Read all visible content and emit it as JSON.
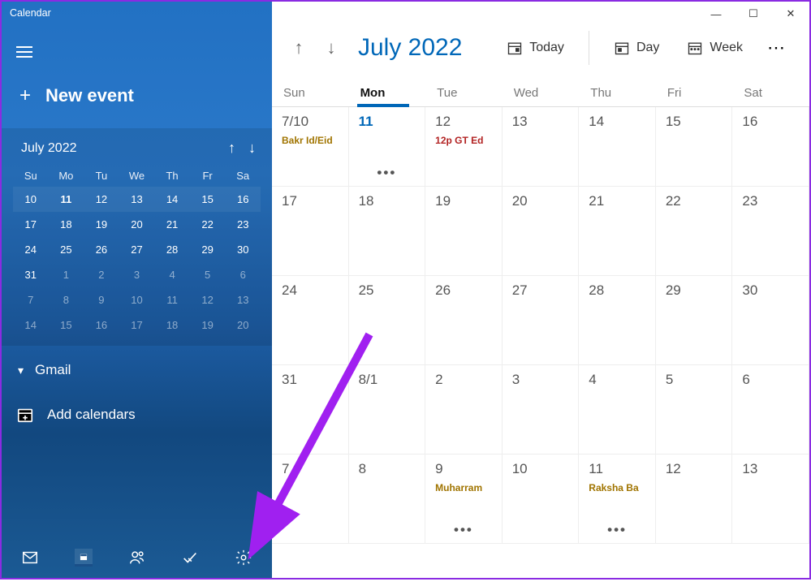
{
  "app_title": "Calendar",
  "new_event_label": "New event",
  "mini_cal": {
    "title": "July 2022",
    "dow": [
      "Su",
      "Mo",
      "Tu",
      "We",
      "Th",
      "Fr",
      "Sa"
    ],
    "weeks": [
      [
        {
          "n": "10"
        },
        {
          "n": "11",
          "today": true
        },
        {
          "n": "12"
        },
        {
          "n": "13"
        },
        {
          "n": "14"
        },
        {
          "n": "15"
        },
        {
          "n": "16"
        }
      ],
      [
        {
          "n": "17"
        },
        {
          "n": "18"
        },
        {
          "n": "19"
        },
        {
          "n": "20"
        },
        {
          "n": "21"
        },
        {
          "n": "22"
        },
        {
          "n": "23"
        }
      ],
      [
        {
          "n": "24"
        },
        {
          "n": "25"
        },
        {
          "n": "26"
        },
        {
          "n": "27"
        },
        {
          "n": "28"
        },
        {
          "n": "29"
        },
        {
          "n": "30"
        }
      ],
      [
        {
          "n": "31"
        },
        {
          "n": "1",
          "other": true
        },
        {
          "n": "2",
          "other": true
        },
        {
          "n": "3",
          "other": true
        },
        {
          "n": "4",
          "other": true
        },
        {
          "n": "5",
          "other": true
        },
        {
          "n": "6",
          "other": true
        }
      ],
      [
        {
          "n": "7",
          "other": true
        },
        {
          "n": "8",
          "other": true
        },
        {
          "n": "9",
          "other": true
        },
        {
          "n": "10",
          "other": true
        },
        {
          "n": "11",
          "other": true
        },
        {
          "n": "12",
          "other": true
        },
        {
          "n": "13",
          "other": true
        }
      ],
      [
        {
          "n": "14",
          "other": true
        },
        {
          "n": "15",
          "other": true
        },
        {
          "n": "16",
          "other": true
        },
        {
          "n": "17",
          "other": true
        },
        {
          "n": "18",
          "other": true
        },
        {
          "n": "19",
          "other": true
        },
        {
          "n": "20",
          "other": true
        }
      ]
    ]
  },
  "account_label": "Gmail",
  "add_calendars_label": "Add calendars",
  "toolbar": {
    "title": "July 2022",
    "today": "Today",
    "day": "Day",
    "week": "Week"
  },
  "dow": [
    "Sun",
    "Mon",
    "Tue",
    "Wed",
    "Thu",
    "Fri",
    "Sat"
  ],
  "today_index": 1,
  "weeks": [
    [
      {
        "n": "7/10",
        "events": [
          {
            "t": "Bakr Id/Eid",
            "c": "gold"
          }
        ]
      },
      {
        "n": "11",
        "today": true,
        "dots": true
      },
      {
        "n": "12",
        "events": [
          {
            "t": "12p GT Ed",
            "c": "red"
          }
        ]
      },
      {
        "n": "13"
      },
      {
        "n": "14"
      },
      {
        "n": "15"
      },
      {
        "n": "16"
      }
    ],
    [
      {
        "n": "17"
      },
      {
        "n": "18"
      },
      {
        "n": "19"
      },
      {
        "n": "20"
      },
      {
        "n": "21"
      },
      {
        "n": "22"
      },
      {
        "n": "23"
      }
    ],
    [
      {
        "n": "24"
      },
      {
        "n": "25"
      },
      {
        "n": "26"
      },
      {
        "n": "27"
      },
      {
        "n": "28"
      },
      {
        "n": "29"
      },
      {
        "n": "30"
      }
    ],
    [
      {
        "n": "31"
      },
      {
        "n": "8/1"
      },
      {
        "n": "2"
      },
      {
        "n": "3"
      },
      {
        "n": "4"
      },
      {
        "n": "5"
      },
      {
        "n": "6"
      }
    ],
    [
      {
        "n": "7"
      },
      {
        "n": "8"
      },
      {
        "n": "9",
        "events": [
          {
            "t": "Muharram",
            "c": "gold"
          }
        ],
        "dots": true
      },
      {
        "n": "10"
      },
      {
        "n": "11",
        "events": [
          {
            "t": "Raksha Ba",
            "c": "gold"
          }
        ],
        "dots": true
      },
      {
        "n": "12"
      },
      {
        "n": "13"
      }
    ]
  ]
}
